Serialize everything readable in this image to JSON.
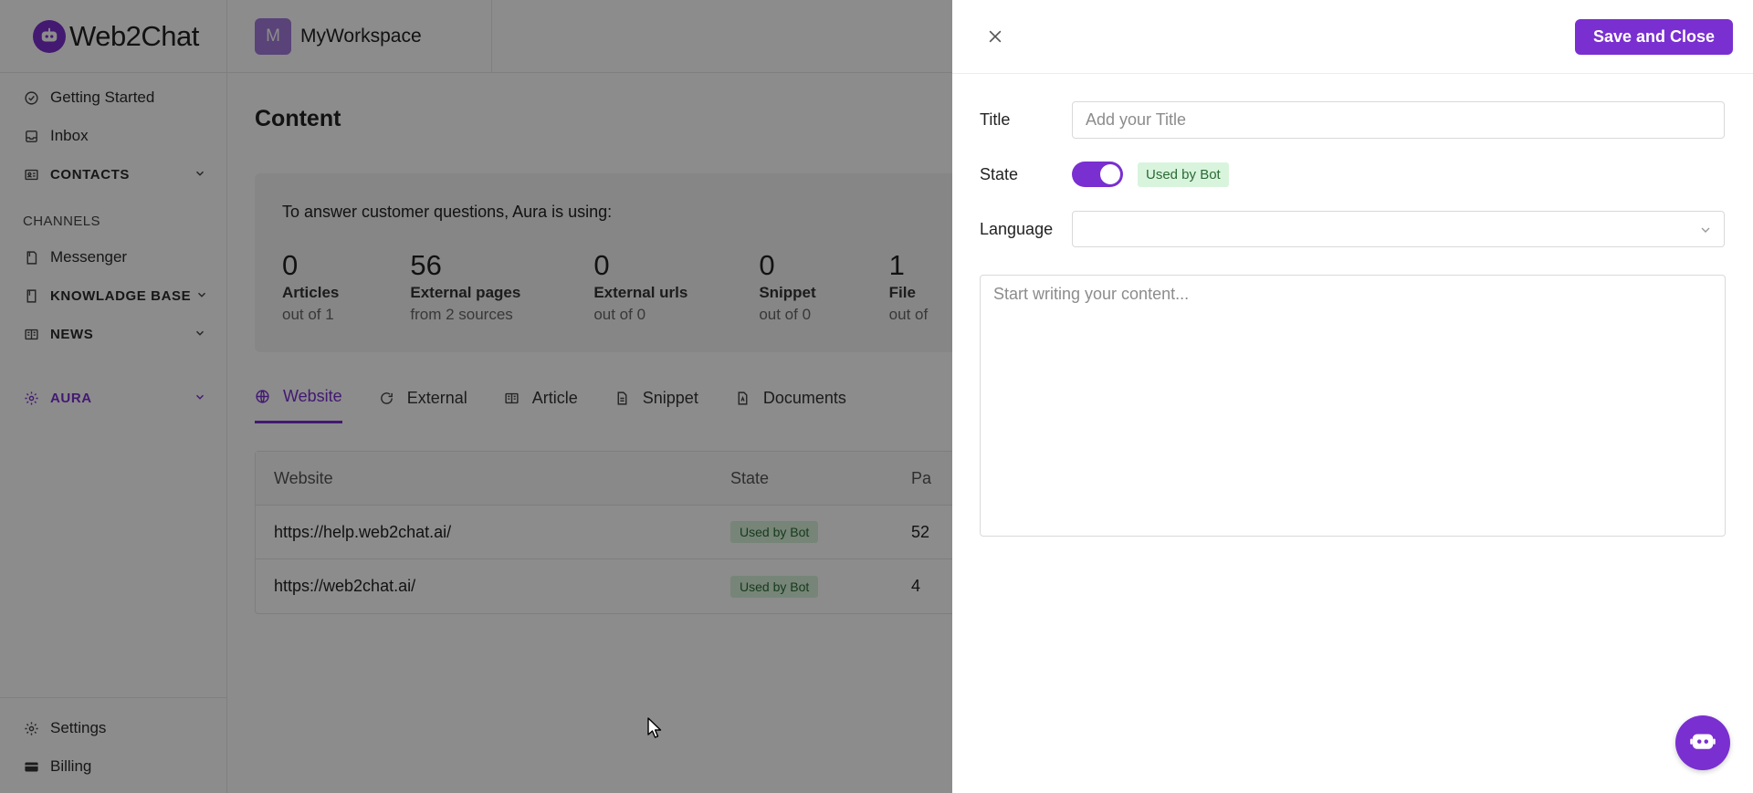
{
  "app": {
    "brand": "Web2Chat"
  },
  "sidebar": {
    "items": [
      {
        "label": "Getting Started",
        "icon": "check-circle-icon"
      },
      {
        "label": "Inbox",
        "icon": "inbox-icon"
      },
      {
        "label": "CONTACTS",
        "icon": "contacts-icon"
      }
    ],
    "channels_header": "CHANNELS",
    "channels": [
      {
        "label": "Messenger",
        "icon": "messenger-icon"
      },
      {
        "label": "KNOWLADGE BASE",
        "icon": "book-icon"
      },
      {
        "label": "NEWS",
        "icon": "news-icon"
      }
    ],
    "aura": {
      "label": "AURA",
      "icon": "gear-icon"
    },
    "bottom": [
      {
        "label": "Settings",
        "icon": "settings-icon"
      },
      {
        "label": "Billing",
        "icon": "billing-icon"
      }
    ]
  },
  "workspace": {
    "initial": "M",
    "name": "MyWorkspace"
  },
  "content": {
    "title": "Content",
    "intro": "To answer customer questions, Aura is using:",
    "stats": [
      {
        "value": "0",
        "label": "Articles",
        "sub": "out of 1"
      },
      {
        "value": "56",
        "label": "External pages",
        "sub": "from 2 sources"
      },
      {
        "value": "0",
        "label": "External urls",
        "sub": "out of 0"
      },
      {
        "value": "0",
        "label": "Snippet",
        "sub": "out of 0"
      },
      {
        "value": "1",
        "label": "File",
        "sub": "out of"
      }
    ],
    "tabs": [
      "Website",
      "External",
      "Article",
      "Snippet",
      "Documents"
    ],
    "table": {
      "headers": [
        "Website",
        "State",
        "Pa"
      ],
      "rows": [
        {
          "website": "https://help.web2chat.ai/",
          "state": "Used by Bot",
          "pages": "52"
        },
        {
          "website": "https://web2chat.ai/",
          "state": "Used by Bot",
          "pages": "4"
        }
      ]
    }
  },
  "drawer": {
    "save_label": "Save and Close",
    "title_label": "Title",
    "title_placeholder": "Add your Title",
    "title_value": "",
    "state_label": "State",
    "state_on": true,
    "state_badge": "Used by Bot",
    "language_label": "Language",
    "language_value": "",
    "content_placeholder": "Start writing your content..."
  },
  "colors": {
    "accent": "#7a2fd0",
    "badge_bg": "#d9f4dd",
    "badge_text": "#2b6b35"
  }
}
